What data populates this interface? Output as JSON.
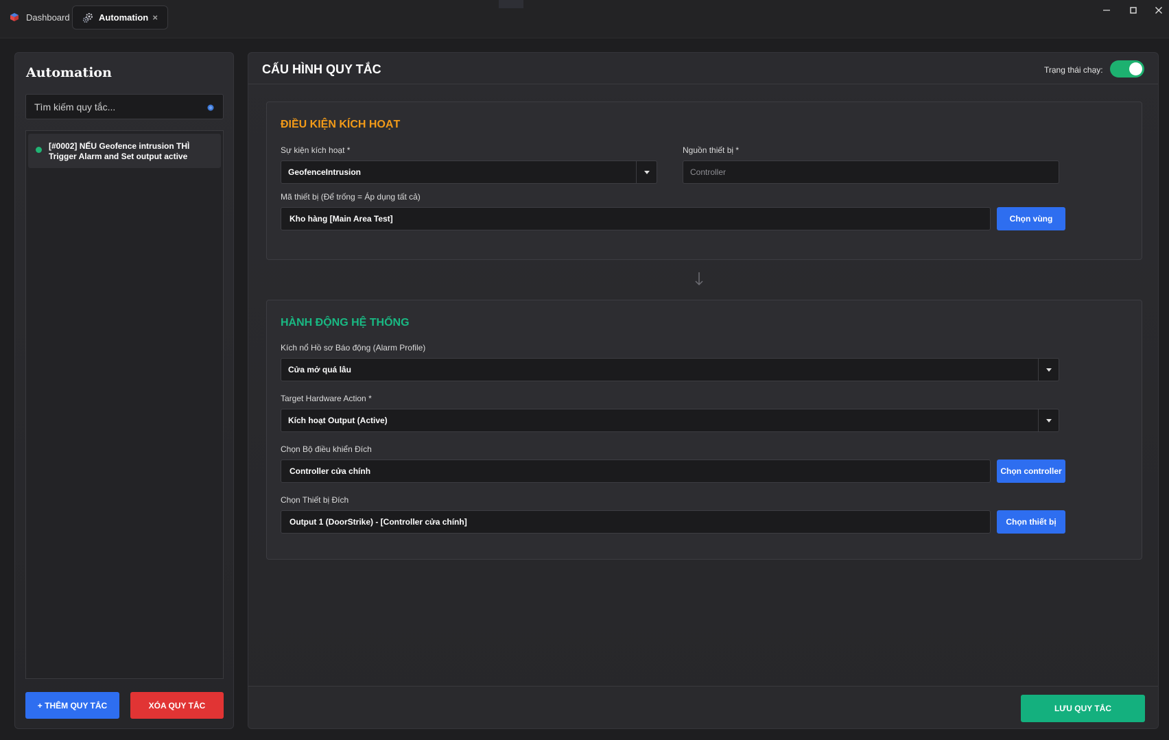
{
  "titlebar": {
    "tabs": [
      {
        "label": "Dashboard",
        "icon": "cube-icon",
        "active": false
      },
      {
        "label": "Automation",
        "icon": "gears-icon",
        "active": true,
        "close": "×"
      }
    ],
    "window_controls": {
      "minimize": "—",
      "maximize": "☐",
      "close": "✕"
    }
  },
  "sidebar": {
    "title": "Automation",
    "search_placeholder": "Tìm kiếm quy tắc...",
    "rules": [
      {
        "text": "[#0002] NẾU Geofence intrusion THÌ Trigger Alarm and Set output active",
        "status_color": "#20b474"
      }
    ],
    "add_label": "+ THÊM QUY TẮC",
    "delete_label": "XÓA QUY TẮC"
  },
  "main": {
    "title": "CẤU HÌNH QUY TẮC",
    "run_status_label": "Trạng thái chạy:",
    "run_status_on": true,
    "trigger": {
      "title": "ĐIỀU KIỆN KÍCH HOẠT",
      "event_label": "Sự kiện kích hoạt *",
      "event_value": "GeofenceIntrusion",
      "source_label": "Nguồn thiết bị *",
      "source_placeholder": "Controller",
      "device_label": "Mã thiết bị (Để trống = Áp dụng tất cả)",
      "device_value": "Kho hàng [Main Area Test]",
      "choose_zone_label": "Chọn vùng"
    },
    "action": {
      "title": "HÀNH ĐỘNG HỆ THỐNG",
      "alarm_label": "Kích nổ Hồ sơ Báo động (Alarm Profile)",
      "alarm_value": "Cửa mở quá lâu",
      "hw_label": "Target Hardware Action *",
      "hw_value": "Kích hoạt Output (Active)",
      "controller_label": "Chọn Bộ điều khiển Đích",
      "controller_value": "Controller cửa chính",
      "choose_controller_label": "Chọn controller",
      "target_label": "Chọn Thiết bị Đích",
      "target_value": "Output 1 (DoorStrike) - [Controller cửa chính]",
      "choose_device_label": "Chọn thiết bị"
    },
    "save_label": "LƯU QUY TẮC"
  },
  "colors": {
    "accent_blue": "#2e6ef0",
    "danger_red": "#e13434",
    "success_green": "#14b07e",
    "trigger_orange": "#f29a18",
    "action_green": "#19b983"
  }
}
